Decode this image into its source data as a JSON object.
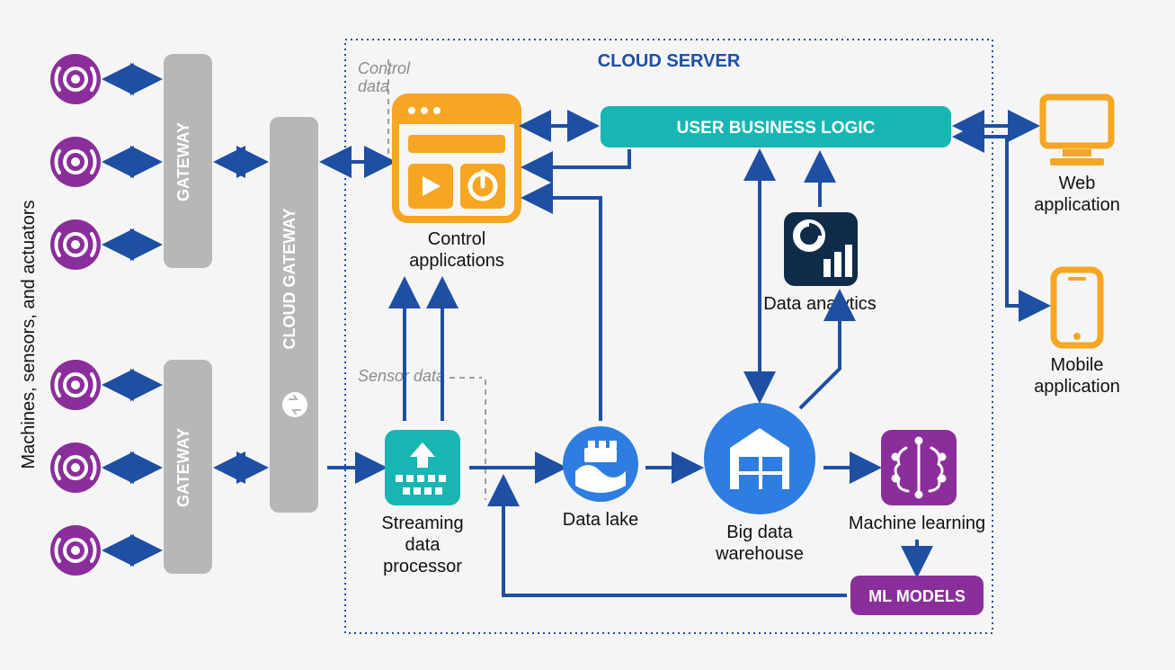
{
  "left_axis_label": "Machines, sensors, and actuators",
  "gateway_label": "GATEWAY",
  "cloud_gateway_label": "CLOUD GATEWAY",
  "cloud_server_title": "CLOUD SERVER",
  "control_data_label": "Control data",
  "sensor_data_label": "Sensor data",
  "control_applications_label": "Control\napplications",
  "user_business_logic_label": "USER BUSINESS LOGIC",
  "data_analytics_label": "Data analytics",
  "streaming_data_processor_label": "Streaming\ndata\nprocessor",
  "data_lake_label": "Data lake",
  "big_data_warehouse_label": "Big data\nwarehouse",
  "machine_learning_label": "Machine learning",
  "ml_models_label": "ML MODELS",
  "web_application_label": "Web\napplication",
  "mobile_application_label": "Mobile\napplication",
  "colors": {
    "purple": "#8A2E9B",
    "purple_dark": "#7B2A8A",
    "gray": "#B7B7B7",
    "gray_text": "#8D8D8D",
    "blue": "#1E4FA3",
    "blue_bright": "#2E7DE0",
    "teal": "#17B6B2",
    "orange": "#F6A623",
    "navy": "#0F2C4A"
  }
}
